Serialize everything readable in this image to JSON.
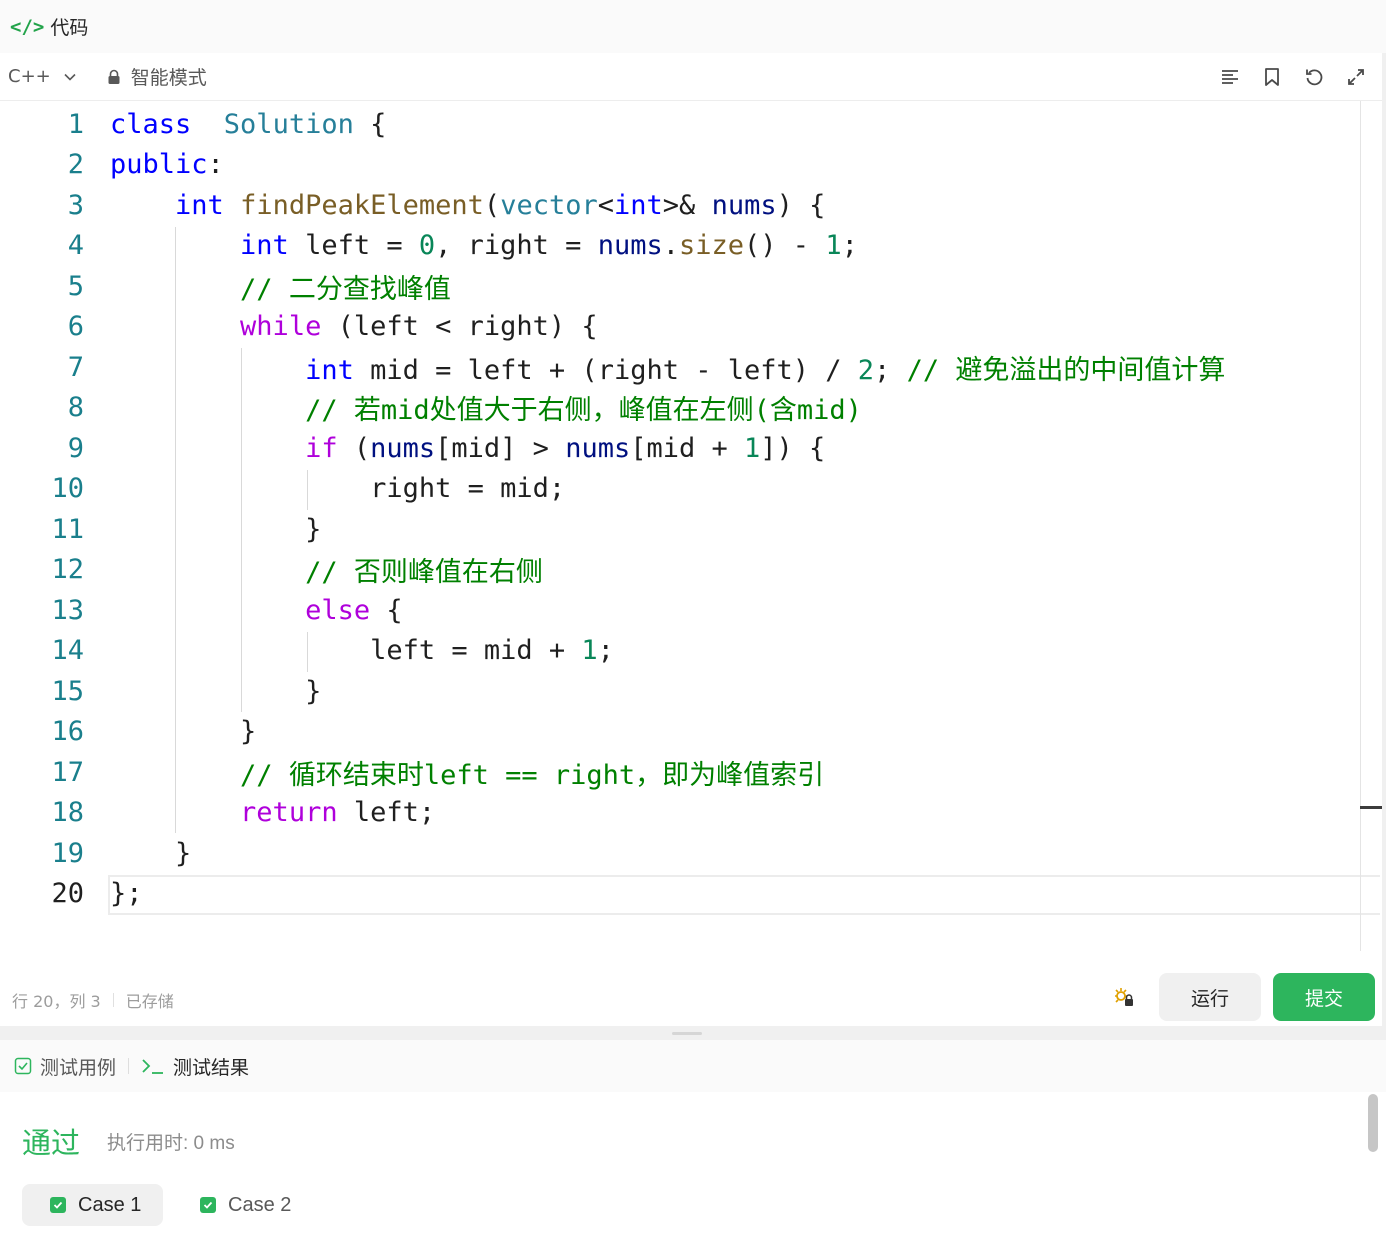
{
  "panel": {
    "title": "代码",
    "icon": "code-icon"
  },
  "toolbar": {
    "language": "C++",
    "mode": "智能模式",
    "icons": [
      "format-icon",
      "bookmark-icon",
      "reset-icon",
      "expand-icon"
    ]
  },
  "editor": {
    "line_numbers": [
      "1",
      "2",
      "3",
      "4",
      "5",
      "6",
      "7",
      "8",
      "9",
      "10",
      "11",
      "12",
      "13",
      "14",
      "15",
      "16",
      "17",
      "18",
      "19",
      "20"
    ],
    "active_line": 20,
    "lines": [
      [
        [
          "kw",
          "class"
        ],
        [
          "",
          "  "
        ],
        [
          "cls",
          "Solution"
        ],
        [
          "",
          " {"
        ]
      ],
      [
        [
          "kw",
          "public"
        ],
        [
          "",
          ":"
        ]
      ],
      [
        [
          "",
          "    "
        ],
        [
          "kw",
          "int"
        ],
        [
          "",
          " "
        ],
        [
          "fn",
          "findPeakElement"
        ],
        [
          "",
          "("
        ],
        [
          "cls",
          "vector"
        ],
        [
          "",
          "<"
        ],
        [
          "kw",
          "int"
        ],
        [
          "",
          ">& "
        ],
        [
          "var",
          "nums"
        ],
        [
          "",
          ") {"
        ]
      ],
      [
        [
          "",
          "        "
        ],
        [
          "kw",
          "int"
        ],
        [
          "",
          " left = "
        ],
        [
          "num",
          "0"
        ],
        [
          "",
          ", right = "
        ],
        [
          "var",
          "nums"
        ],
        [
          "",
          "."
        ],
        [
          "fn",
          "size"
        ],
        [
          "",
          "() - "
        ],
        [
          "num",
          "1"
        ],
        [
          "",
          ";"
        ]
      ],
      [
        [
          "",
          "        "
        ],
        [
          "cm",
          "// 二分查找峰值"
        ]
      ],
      [
        [
          "",
          "        "
        ],
        [
          "kw2",
          "while"
        ],
        [
          "",
          " (left < right) {"
        ]
      ],
      [
        [
          "",
          "            "
        ],
        [
          "kw",
          "int"
        ],
        [
          "",
          " mid = left + (right - left) / "
        ],
        [
          "num",
          "2"
        ],
        [
          "",
          "; "
        ],
        [
          "cm",
          "// 避免溢出的中间值计算"
        ]
      ],
      [
        [
          "",
          "            "
        ],
        [
          "cm",
          "// 若mid处值大于右侧，峰值在左侧(含mid)"
        ]
      ],
      [
        [
          "",
          "            "
        ],
        [
          "kw2",
          "if"
        ],
        [
          "",
          " ("
        ],
        [
          "var",
          "nums"
        ],
        [
          "",
          "[mid] > "
        ],
        [
          "var",
          "nums"
        ],
        [
          "",
          "[mid + "
        ],
        [
          "num",
          "1"
        ],
        [
          "",
          "]) {"
        ]
      ],
      [
        [
          "",
          "                right = mid;"
        ]
      ],
      [
        [
          "",
          "            }"
        ]
      ],
      [
        [
          "",
          "            "
        ],
        [
          "cm",
          "// 否则峰值在右侧"
        ]
      ],
      [
        [
          "",
          "            "
        ],
        [
          "kw2",
          "else"
        ],
        [
          "",
          " {"
        ]
      ],
      [
        [
          "",
          "                left = mid + "
        ],
        [
          "num",
          "1"
        ],
        [
          "",
          ";"
        ]
      ],
      [
        [
          "",
          "            }"
        ]
      ],
      [
        [
          "",
          "        }"
        ]
      ],
      [
        [
          "",
          "        "
        ],
        [
          "cm",
          "// 循环结束时left == right，即为峰值索引"
        ]
      ],
      [
        [
          "",
          "        "
        ],
        [
          "kw2",
          "return"
        ],
        [
          "",
          " left;"
        ]
      ],
      [
        [
          "",
          "    }"
        ]
      ],
      [
        [
          "",
          "};"
        ]
      ]
    ],
    "colors": {
      "keyword": "#0000ff",
      "control": "#af00db",
      "type": "#267f99",
      "function": "#795e26",
      "number": "#098658",
      "variable": "#001080",
      "comment": "#008000"
    }
  },
  "status": {
    "position": "行 20，列 3",
    "saved": "已存储",
    "run_label": "运行",
    "submit_label": "提交",
    "submit_color": "#2db55d"
  },
  "bottom": {
    "tab_testcase": "测试用例",
    "tab_result": "测试结果",
    "result_status": "通过",
    "runtime": "执行用时: 0 ms",
    "cases": [
      "Case 1",
      "Case 2"
    ]
  }
}
